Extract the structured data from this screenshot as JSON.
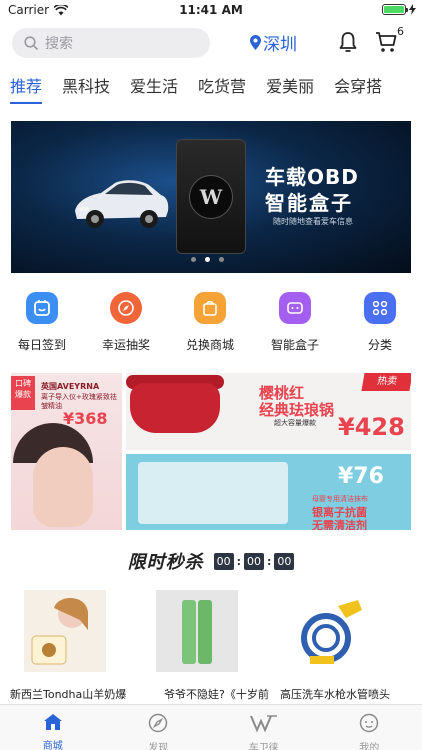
{
  "status_bar": {
    "carrier": "Carrier",
    "time": "11:41 AM"
  },
  "header": {
    "search_placeholder": "搜索",
    "location": "深圳",
    "cart_count": "6"
  },
  "tabs": [
    {
      "label": "推荐",
      "active": true
    },
    {
      "label": "黑科技"
    },
    {
      "label": "爱生活"
    },
    {
      "label": "吃货营"
    },
    {
      "label": "爱美丽"
    },
    {
      "label": "会穿搭"
    }
  ],
  "banner": {
    "title": "车载OBD",
    "subtitle": "智能盒子",
    "caption": "随时随地查看爱车信息",
    "logo_letter": "W",
    "dots": 3,
    "active_dot": 2
  },
  "quick_actions": [
    {
      "label": "每日签到",
      "icon": "calendar-check-icon",
      "color": "#3b8ff3"
    },
    {
      "label": "幸运抽奖",
      "icon": "compass-icon",
      "color": "#f0653a"
    },
    {
      "label": "兑换商城",
      "icon": "shopping-bag-icon",
      "color": "#f5a236"
    },
    {
      "label": "智能盒子",
      "icon": "smart-box-icon",
      "color": "#a45ff0"
    },
    {
      "label": "分类",
      "icon": "category-grid-icon",
      "color": "#4a6ff0"
    }
  ],
  "promos": {
    "left": {
      "tag": "口碑爆款",
      "line1": "英国AVEYRNA",
      "line2": "离子导入仪+玫瑰紧致祛皱精油",
      "price": "¥368"
    },
    "right_top": {
      "line1": "樱桃红",
      "line2": "经典珐琅锅",
      "line3": "超大容量爆款",
      "price": "¥428",
      "hot": "热卖"
    },
    "right_bottom": {
      "price": "¥76",
      "line1": "母婴专用清洁抹布",
      "line2": "银离子抗菌",
      "line3": "无需清洁剂"
    }
  },
  "flash_sale": {
    "title": "限时秒杀",
    "hours": "00",
    "minutes": "00",
    "seconds": "00"
  },
  "products": [
    {
      "name": "新西兰Tondha山羊奶爆"
    },
    {
      "name": "爷爷不隐娃?《十岁前"
    },
    {
      "name": "高压洗车水枪水管喷头"
    }
  ],
  "tabbar": [
    {
      "label": "商城",
      "icon": "home-icon",
      "active": true
    },
    {
      "label": "发现",
      "icon": "compass-icon"
    },
    {
      "label": "车卫徕",
      "icon": "brand-w-icon"
    },
    {
      "label": "我的",
      "icon": "profile-icon"
    }
  ]
}
